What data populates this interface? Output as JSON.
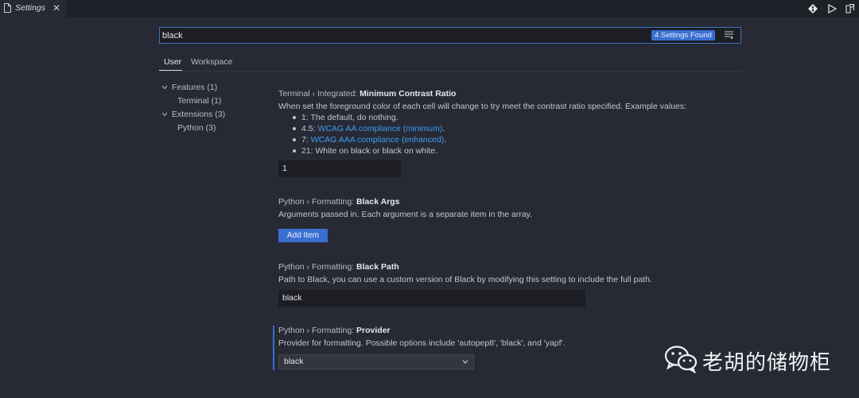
{
  "tab": {
    "title": "Settings",
    "close": "✕"
  },
  "search": {
    "value": "black",
    "results": "4 Settings Found"
  },
  "scope_tabs": [
    "User",
    "Workspace"
  ],
  "tree": [
    {
      "label": "Features (1)"
    },
    {
      "label": "Terminal (1)"
    },
    {
      "label": "Extensions (3)"
    },
    {
      "label": "Python (3)"
    }
  ],
  "settings": {
    "contrast": {
      "category": "Terminal › Integrated: ",
      "name": "Minimum Contrast Ratio",
      "description": "When set the foreground color of each cell will change to try meet the contrast ratio specified. Example values:",
      "bullets": [
        {
          "text": "1: The default, do nothing.",
          "prefix": "",
          "link": "",
          "suffix": ""
        },
        {
          "text": "",
          "prefix": "4.5: ",
          "link": "WCAG AA compliance (minimum)",
          "suffix": "."
        },
        {
          "text": "",
          "prefix": "7: ",
          "link": "WCAG AAA compliance (enhanced)",
          "suffix": "."
        },
        {
          "text": "21: White on black or black on white.",
          "prefix": "",
          "link": "",
          "suffix": ""
        }
      ],
      "value": "1"
    },
    "black_args": {
      "category": "Python › Formatting: ",
      "name": "Black Args",
      "description": "Arguments passed in. Each argument is a separate item in the array.",
      "button": "Add Item"
    },
    "black_path": {
      "category": "Python › Formatting: ",
      "name": "Black Path",
      "description": "Path to Black, you can use a custom version of Black by modifying this setting to include the full path.",
      "value": "black"
    },
    "provider": {
      "category": "Python › Formatting: ",
      "name": "Provider",
      "description": "Provider for formatting. Possible options include 'autopep8', 'black', and 'yapf'.",
      "value": "black"
    }
  },
  "watermark": {
    "text": "老胡的储物柜"
  },
  "colors": {
    "accent": "#3a6fd0",
    "link": "#3d9df3",
    "background": "#272a34"
  }
}
